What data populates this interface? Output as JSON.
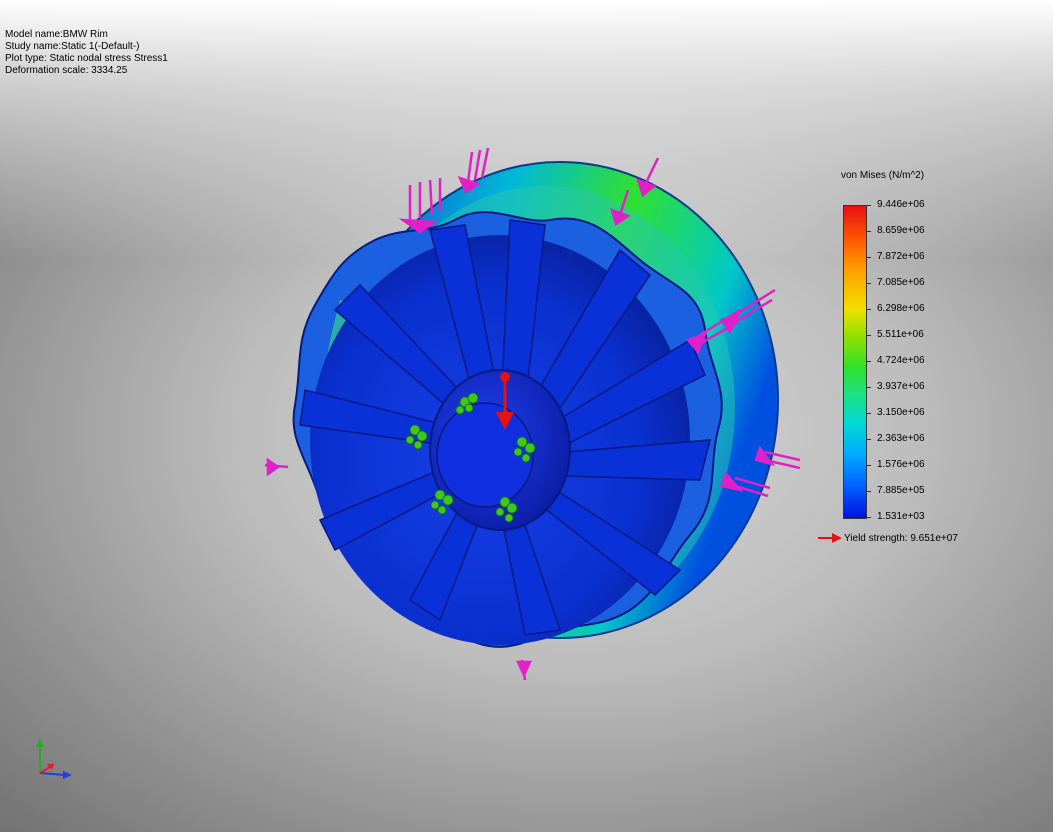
{
  "info": {
    "model_name": "Model name:BMW Rim",
    "study_name": "Study name:Static 1(-Default-)",
    "plot_type": "Plot type: Static nodal stress Stress1",
    "deformation_scale": "Deformation scale: 3334.25"
  },
  "legend": {
    "title": "von Mises (N/m^2)",
    "ticks": [
      "9.446e+06",
      "8.659e+06",
      "7.872e+06",
      "7.085e+06",
      "6.298e+06",
      "5.511e+06",
      "4.724e+06",
      "3.937e+06",
      "3.150e+06",
      "2.363e+06",
      "1.576e+06",
      "7.885e+05",
      "1.531e+03"
    ],
    "yield_label": "Yield strength: 9.651e+07"
  },
  "colors": {
    "max": "#e81010",
    "high": "#ff8c00",
    "mid_high": "#f0e000",
    "mid": "#2ee02e",
    "low_mid": "#00d8d8",
    "low": "#0078ff",
    "min": "#0010e0",
    "force_arrows": "#e020c8",
    "fixtures": "#3cc81e"
  },
  "icons": {
    "load_arrows": "force-arrow-icon",
    "fixtures": "fixture-icon",
    "triad": "axis-triad-icon"
  }
}
